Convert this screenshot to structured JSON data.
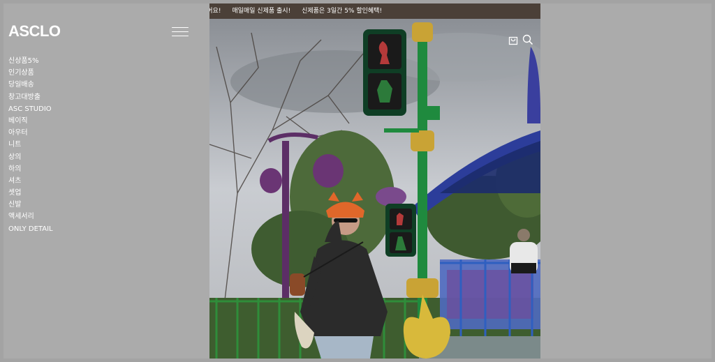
{
  "brand": {
    "logo_text": "ASCLO"
  },
  "sidebar": {
    "menu_items": [
      {
        "label": "신상품5%"
      },
      {
        "label": "인기상품"
      },
      {
        "label": "당일배송"
      },
      {
        "label": "창고대방출"
      },
      {
        "label": "ASC STUDIO"
      },
      {
        "label": "베이직"
      },
      {
        "label": "아우터"
      },
      {
        "label": "니트"
      },
      {
        "label": "상의"
      },
      {
        "label": "하의"
      },
      {
        "label": "셔츠"
      },
      {
        "label": "셋업"
      },
      {
        "label": "신발"
      },
      {
        "label": "액세서리"
      },
      {
        "label": "ONLY DETAIL"
      }
    ]
  },
  "banner": {
    "messages": [
      "있어요!",
      "매일매일 신제품 출시!",
      "신제품은 3일간 5% 할인혜택!"
    ]
  },
  "icons": {
    "menu": "hamburger-menu-icon",
    "cart": "shopping-bag-icon",
    "search": "search-icon"
  },
  "colors": {
    "overlay_gray": "#ababab",
    "banner_bg": "#4b4038",
    "text_white": "#ffffff"
  }
}
